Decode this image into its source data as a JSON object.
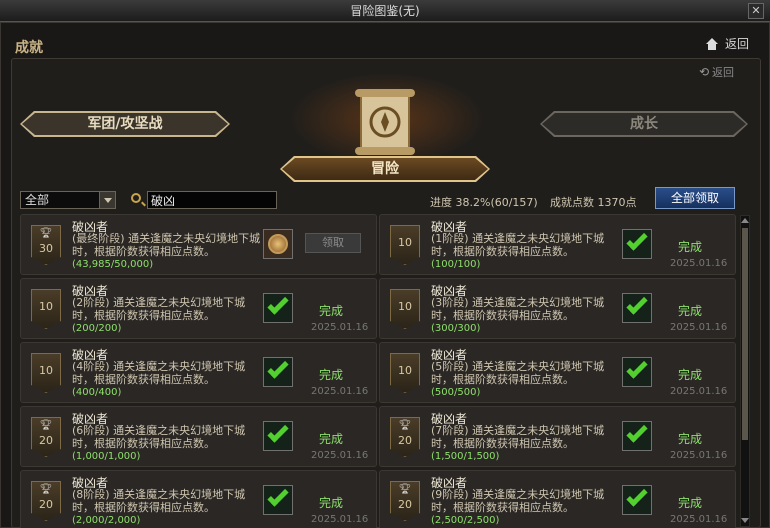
{
  "window": {
    "title": "冒险图鉴(无)",
    "close_glyph": "✕"
  },
  "header": {
    "section_title": "成就",
    "back_label": "返回"
  },
  "sub_nav": {
    "back_label": "返回",
    "icon": "cycle-icon"
  },
  "tabs": {
    "left": "军团/攻坚战",
    "center": "冒险",
    "right": "成长"
  },
  "filter": {
    "selected": "全部"
  },
  "search": {
    "value": "破凶"
  },
  "stats": {
    "progress": "进度  38.2%(60/157)",
    "points": "成就点数 1370点"
  },
  "claim_all_label": "全部领取",
  "colors": {
    "accent_gold": "#c9a44b",
    "complete_green": "#8ee06c",
    "button_blue": "#2a4e8a"
  },
  "achievements": [
    {
      "title": "破凶者",
      "points": "30",
      "trophy": true,
      "desc": "(最终阶段) 通关逢魔之未央幻境地下城时，根据阶数获得相应点数。",
      "progress": "(43,985/50,000)",
      "status": "claim",
      "claim_label": "领取",
      "date": ""
    },
    {
      "title": "破凶者",
      "points": "10",
      "trophy": false,
      "desc": "(1阶段) 通关逢魔之未央幻境地下城时，根据阶数获得相应点数。",
      "progress": "(100/100)",
      "status": "完成",
      "date": "2025.01.16"
    },
    {
      "title": "破凶者",
      "points": "10",
      "trophy": false,
      "desc": "(2阶段) 通关逢魔之未央幻境地下城时，根据阶数获得相应点数。",
      "progress": "(200/200)",
      "status": "完成",
      "date": "2025.01.16"
    },
    {
      "title": "破凶者",
      "points": "10",
      "trophy": false,
      "desc": "(3阶段) 通关逢魔之未央幻境地下城时，根据阶数获得相应点数。",
      "progress": "(300/300)",
      "status": "完成",
      "date": "2025.01.16"
    },
    {
      "title": "破凶者",
      "points": "10",
      "trophy": false,
      "desc": "(4阶段) 通关逢魔之未央幻境地下城时，根据阶数获得相应点数。",
      "progress": "(400/400)",
      "status": "完成",
      "date": "2025.01.16"
    },
    {
      "title": "破凶者",
      "points": "10",
      "trophy": false,
      "desc": "(5阶段) 通关逢魔之未央幻境地下城时，根据阶数获得相应点数。",
      "progress": "(500/500)",
      "status": "完成",
      "date": "2025.01.16"
    },
    {
      "title": "破凶者",
      "points": "20",
      "trophy": true,
      "desc": "(6阶段) 通关逢魔之未央幻境地下城时，根据阶数获得相应点数。",
      "progress": "(1,000/1,000)",
      "status": "完成",
      "date": "2025.01.16"
    },
    {
      "title": "破凶者",
      "points": "20",
      "trophy": true,
      "desc": "(7阶段) 通关逢魔之未央幻境地下城时，根据阶数获得相应点数。",
      "progress": "(1,500/1,500)",
      "status": "完成",
      "date": "2025.01.16"
    },
    {
      "title": "破凶者",
      "points": "20",
      "trophy": true,
      "desc": "(8阶段) 通关逢魔之未央幻境地下城时，根据阶数获得相应点数。",
      "progress": "(2,000/2,000)",
      "status": "完成",
      "date": "2025.01.16"
    },
    {
      "title": "破凶者",
      "points": "20",
      "trophy": true,
      "desc": "(9阶段) 通关逢魔之未央幻境地下城时，根据阶数获得相应点数。",
      "progress": "(2,500/2,500)",
      "status": "完成",
      "date": "2025.01.16"
    }
  ]
}
